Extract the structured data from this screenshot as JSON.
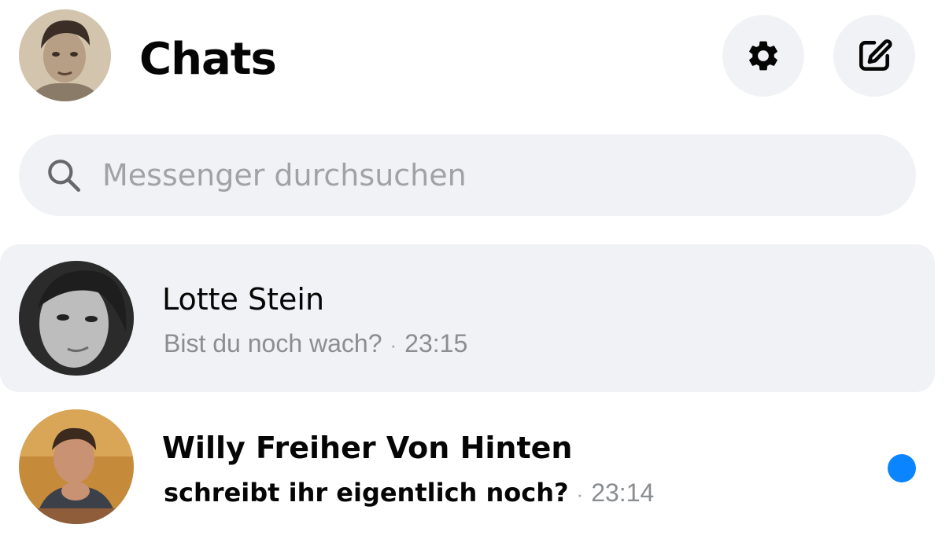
{
  "header": {
    "title": "Chats",
    "settings_icon": "gear-icon",
    "compose_icon": "compose-icon"
  },
  "search": {
    "placeholder": "Messenger durchsuchen",
    "value": ""
  },
  "chats": [
    {
      "name": "Lotte Stein",
      "preview": "Bist du noch wach?",
      "separator": "·",
      "time": "23:15",
      "active": true,
      "unread": false
    },
    {
      "name": "Willy Freiher Von Hinten",
      "preview": "schreibt ihr eigentlich noch?",
      "separator": "·",
      "time": "23:14",
      "active": false,
      "unread": true
    }
  ],
  "colors": {
    "accent": "#0a84ff",
    "button_bg": "#f0f2f5",
    "text_primary": "#050505",
    "text_secondary": "#8a8d91"
  }
}
